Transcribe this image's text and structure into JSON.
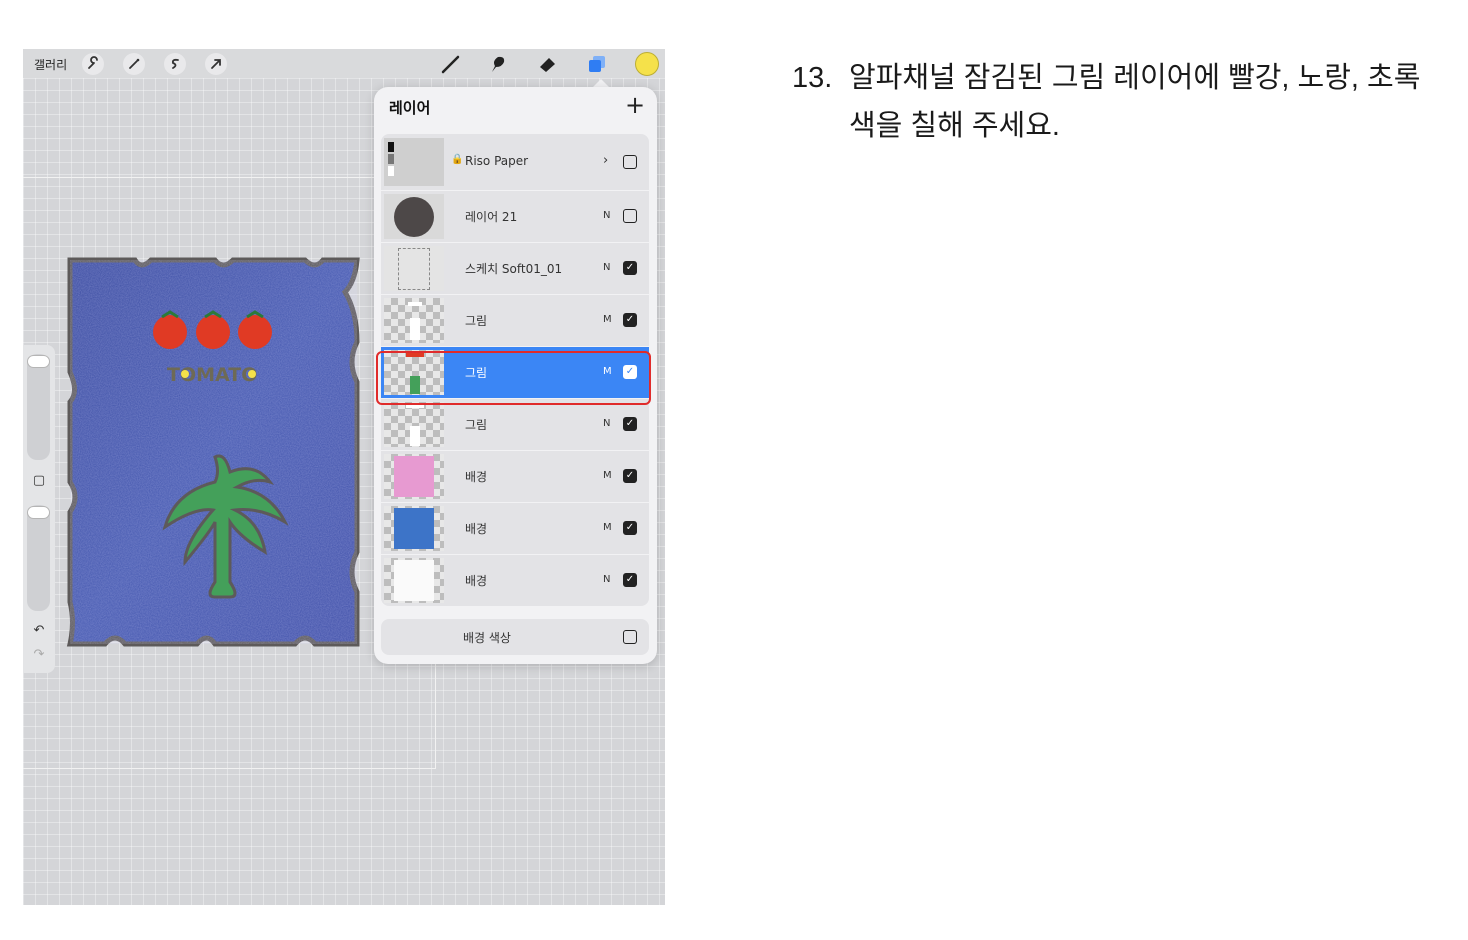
{
  "topbar": {
    "gallery_label": "갤러리",
    "left_icons": [
      "wrench-icon",
      "magic-wand-icon",
      "selection-icon",
      "transform-arrow-icon"
    ],
    "tools": [
      "brush-icon",
      "smudge-icon",
      "eraser-icon",
      "layers-icon"
    ],
    "active_color": "#f5e14a"
  },
  "layers_panel": {
    "title": "레이어",
    "add_symbol": "+",
    "layers": [
      {
        "name": "Riso Paper",
        "blend": "›",
        "checked": false,
        "locked": true,
        "group": true
      },
      {
        "name": "레이어 21",
        "blend": "N",
        "checked": false
      },
      {
        "name": "스케치 Soft01_01",
        "blend": "N",
        "checked": true
      },
      {
        "name": "그림",
        "blend": "M",
        "checked": true
      },
      {
        "name": "그림",
        "blend": "M",
        "checked": true,
        "selected": true
      },
      {
        "name": "그림",
        "blend": "N",
        "checked": true
      },
      {
        "name": "배경",
        "blend": "M",
        "checked": true
      },
      {
        "name": "배경",
        "blend": "M",
        "checked": true
      },
      {
        "name": "배경",
        "blend": "N",
        "checked": true
      }
    ],
    "background_color_label": "배경 색상",
    "background_color_checked": false
  },
  "side_controls": {
    "undo_symbol": "↶",
    "redo_symbol": "↷",
    "modify_symbol": "▢"
  },
  "artwork": {
    "tomato_text": "TOMATO"
  },
  "instruction": {
    "number": "13.",
    "text": "알파채널 잠김된 그림 레이어에 빨강, 노랑, 초록색을 칠해 주세요."
  }
}
